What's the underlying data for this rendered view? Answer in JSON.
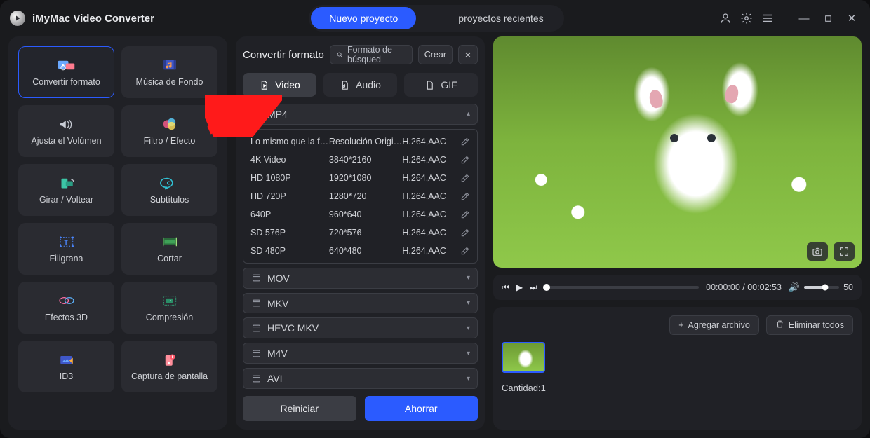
{
  "titlebar": {
    "app_name": "iMyMac Video Converter",
    "new_project": "Nuevo proyecto",
    "recent_projects": "proyectos recientes"
  },
  "tools": [
    {
      "id": "convert",
      "label": "Convertir formato",
      "selected": true
    },
    {
      "id": "music",
      "label": "Música de Fondo",
      "selected": false
    },
    {
      "id": "volume",
      "label": "Ajusta el Volúmen",
      "selected": false
    },
    {
      "id": "filter",
      "label": "Filtro / Efecto",
      "selected": false
    },
    {
      "id": "rotate",
      "label": "Girar / Voltear",
      "selected": false
    },
    {
      "id": "subtitles",
      "label": "Subtítulos",
      "selected": false
    },
    {
      "id": "watermark",
      "label": "Filigrana",
      "selected": false
    },
    {
      "id": "cut",
      "label": "Cortar",
      "selected": false
    },
    {
      "id": "fx3d",
      "label": "Efectos 3D",
      "selected": false
    },
    {
      "id": "compress",
      "label": "Compresión",
      "selected": false
    },
    {
      "id": "id3",
      "label": "ID3",
      "selected": false
    },
    {
      "id": "screen",
      "label": "Captura de pantalla",
      "selected": false
    }
  ],
  "mid": {
    "title": "Convertir formato",
    "search_placeholder": "Formato de búsqued",
    "create_btn": "Crear",
    "tabs": {
      "video": "Video",
      "audio": "Audio",
      "gif": "GIF"
    },
    "expanded_group": "MP4",
    "presets": [
      {
        "name": "Lo mismo que la fu...",
        "res": "Resolución Original",
        "codec": "H.264,AAC"
      },
      {
        "name": "4K Video",
        "res": "3840*2160",
        "codec": "H.264,AAC"
      },
      {
        "name": "HD 1080P",
        "res": "1920*1080",
        "codec": "H.264,AAC"
      },
      {
        "name": "HD 720P",
        "res": "1280*720",
        "codec": "H.264,AAC"
      },
      {
        "name": "640P",
        "res": "960*640",
        "codec": "H.264,AAC"
      },
      {
        "name": "SD 576P",
        "res": "720*576",
        "codec": "H.264,AAC"
      },
      {
        "name": "SD 480P",
        "res": "640*480",
        "codec": "H.264,AAC"
      }
    ],
    "collapsed_groups": [
      "MOV",
      "MKV",
      "HEVC MKV",
      "M4V",
      "AVI"
    ],
    "reset_btn": "Reiniciar",
    "save_btn": "Ahorrar"
  },
  "player": {
    "time_current": "00:00:00",
    "time_total": "00:02:53",
    "volume_value": "50"
  },
  "bottom": {
    "add_file": "Agregar archivo",
    "delete_all": "Eliminar todos",
    "count_label": "Cantidad:",
    "count_value": "1"
  }
}
